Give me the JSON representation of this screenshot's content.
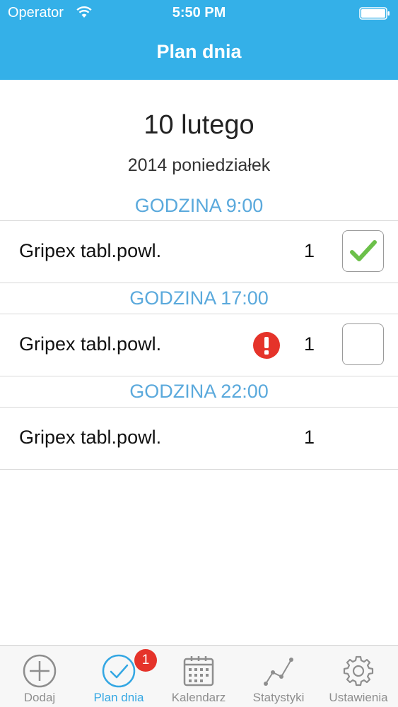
{
  "status_bar": {
    "carrier": "Operator",
    "time": "5:50 PM"
  },
  "nav": {
    "title": "Plan dnia"
  },
  "date": {
    "main": "10 lutego",
    "sub": "2014 poniedziałek"
  },
  "sections": [
    {
      "header": "GODZINA 9:00",
      "item": {
        "name": "Gripex tabl.powl.",
        "quantity": "1",
        "checked": true,
        "alert": false
      }
    },
    {
      "header": "GODZINA 17:00",
      "item": {
        "name": "Gripex tabl.powl.",
        "quantity": "1",
        "checked": false,
        "alert": true
      }
    },
    {
      "header": "GODZINA 22:00",
      "item": {
        "name": "Gripex tabl.powl.",
        "quantity": "1",
        "checked": null,
        "alert": false
      }
    }
  ],
  "tabbar": {
    "tabs": [
      {
        "label": "Dodaj",
        "icon": "add-circle-icon",
        "active": false
      },
      {
        "label": "Plan dnia",
        "icon": "check-circle-icon",
        "active": true,
        "badge": "1"
      },
      {
        "label": "Kalendarz",
        "icon": "calendar-icon",
        "active": false
      },
      {
        "label": "Statystyki",
        "icon": "chart-line-icon",
        "active": false
      },
      {
        "label": "Ustawienia",
        "icon": "gear-icon",
        "active": false
      }
    ]
  },
  "colors": {
    "header_bg": "#34b0e8",
    "section_text": "#5aa9dc",
    "check_green": "#6cc04a",
    "alert_red": "#e5332a",
    "tab_active": "#34a7e3",
    "tab_inactive": "#8e8e8e"
  }
}
